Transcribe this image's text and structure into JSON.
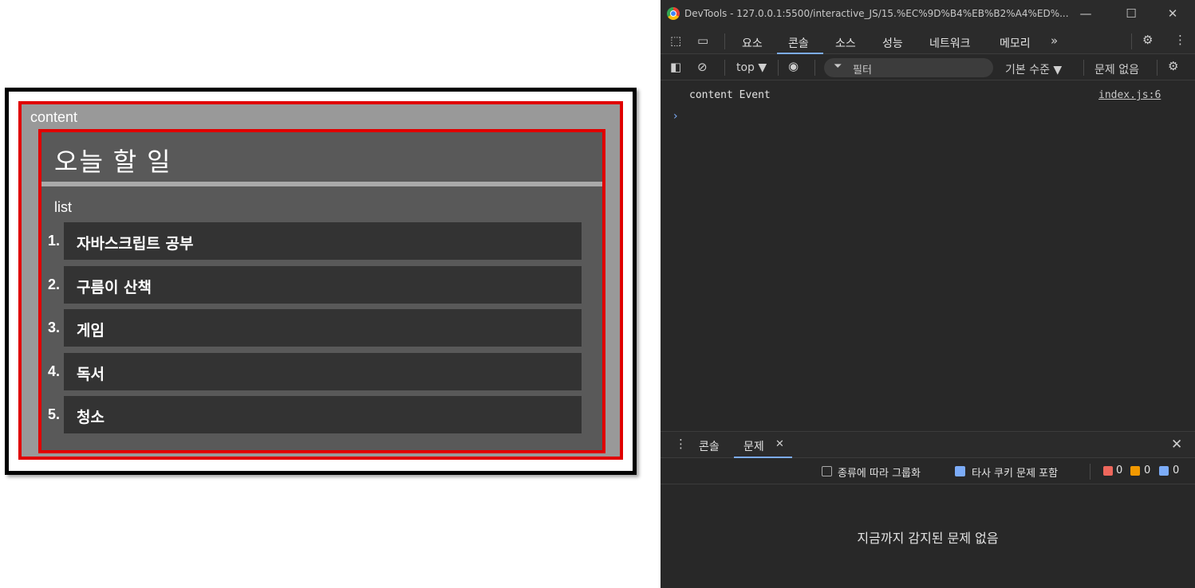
{
  "page": {
    "content_label": "content",
    "todo_title": "오늘 할 일",
    "list_label": "list",
    "items": [
      {
        "num": "1.",
        "text": "자바스크립트 공부"
      },
      {
        "num": "2.",
        "text": "구름이 산책"
      },
      {
        "num": "3.",
        "text": "게임"
      },
      {
        "num": "4.",
        "text": "독서"
      },
      {
        "num": "5.",
        "text": "청소"
      }
    ]
  },
  "devtools": {
    "window_title": "DevTools - 127.0.0.1:5500/interactive_JS/15.%EC%9D%B4%EB%B2%A4%ED%...",
    "tabs": [
      "요소",
      "콘솔",
      "소스",
      "성능",
      "네트워크",
      "메모리"
    ],
    "active_tab": "콘솔",
    "context": "top ▼",
    "filter_placeholder": "필터",
    "level": "기본 수준 ▼",
    "issues_label": "문제 없음",
    "log_message": "content Event",
    "log_source": "index.js:6",
    "drawer_tabs": [
      "콘솔",
      "문제"
    ],
    "group_by_kind": "종류에 따라 그룹화",
    "third_party_cookie": "타사 쿠키 문제 포함",
    "counts": {
      "errors": "0",
      "warnings": "0",
      "info": "0"
    },
    "no_issues_message": "지금까지 감지된 문제 없음"
  },
  "colors": {
    "accent_red": "#e00000",
    "devtools_bg": "#282828",
    "devtools_accent": "#7cacf8"
  }
}
